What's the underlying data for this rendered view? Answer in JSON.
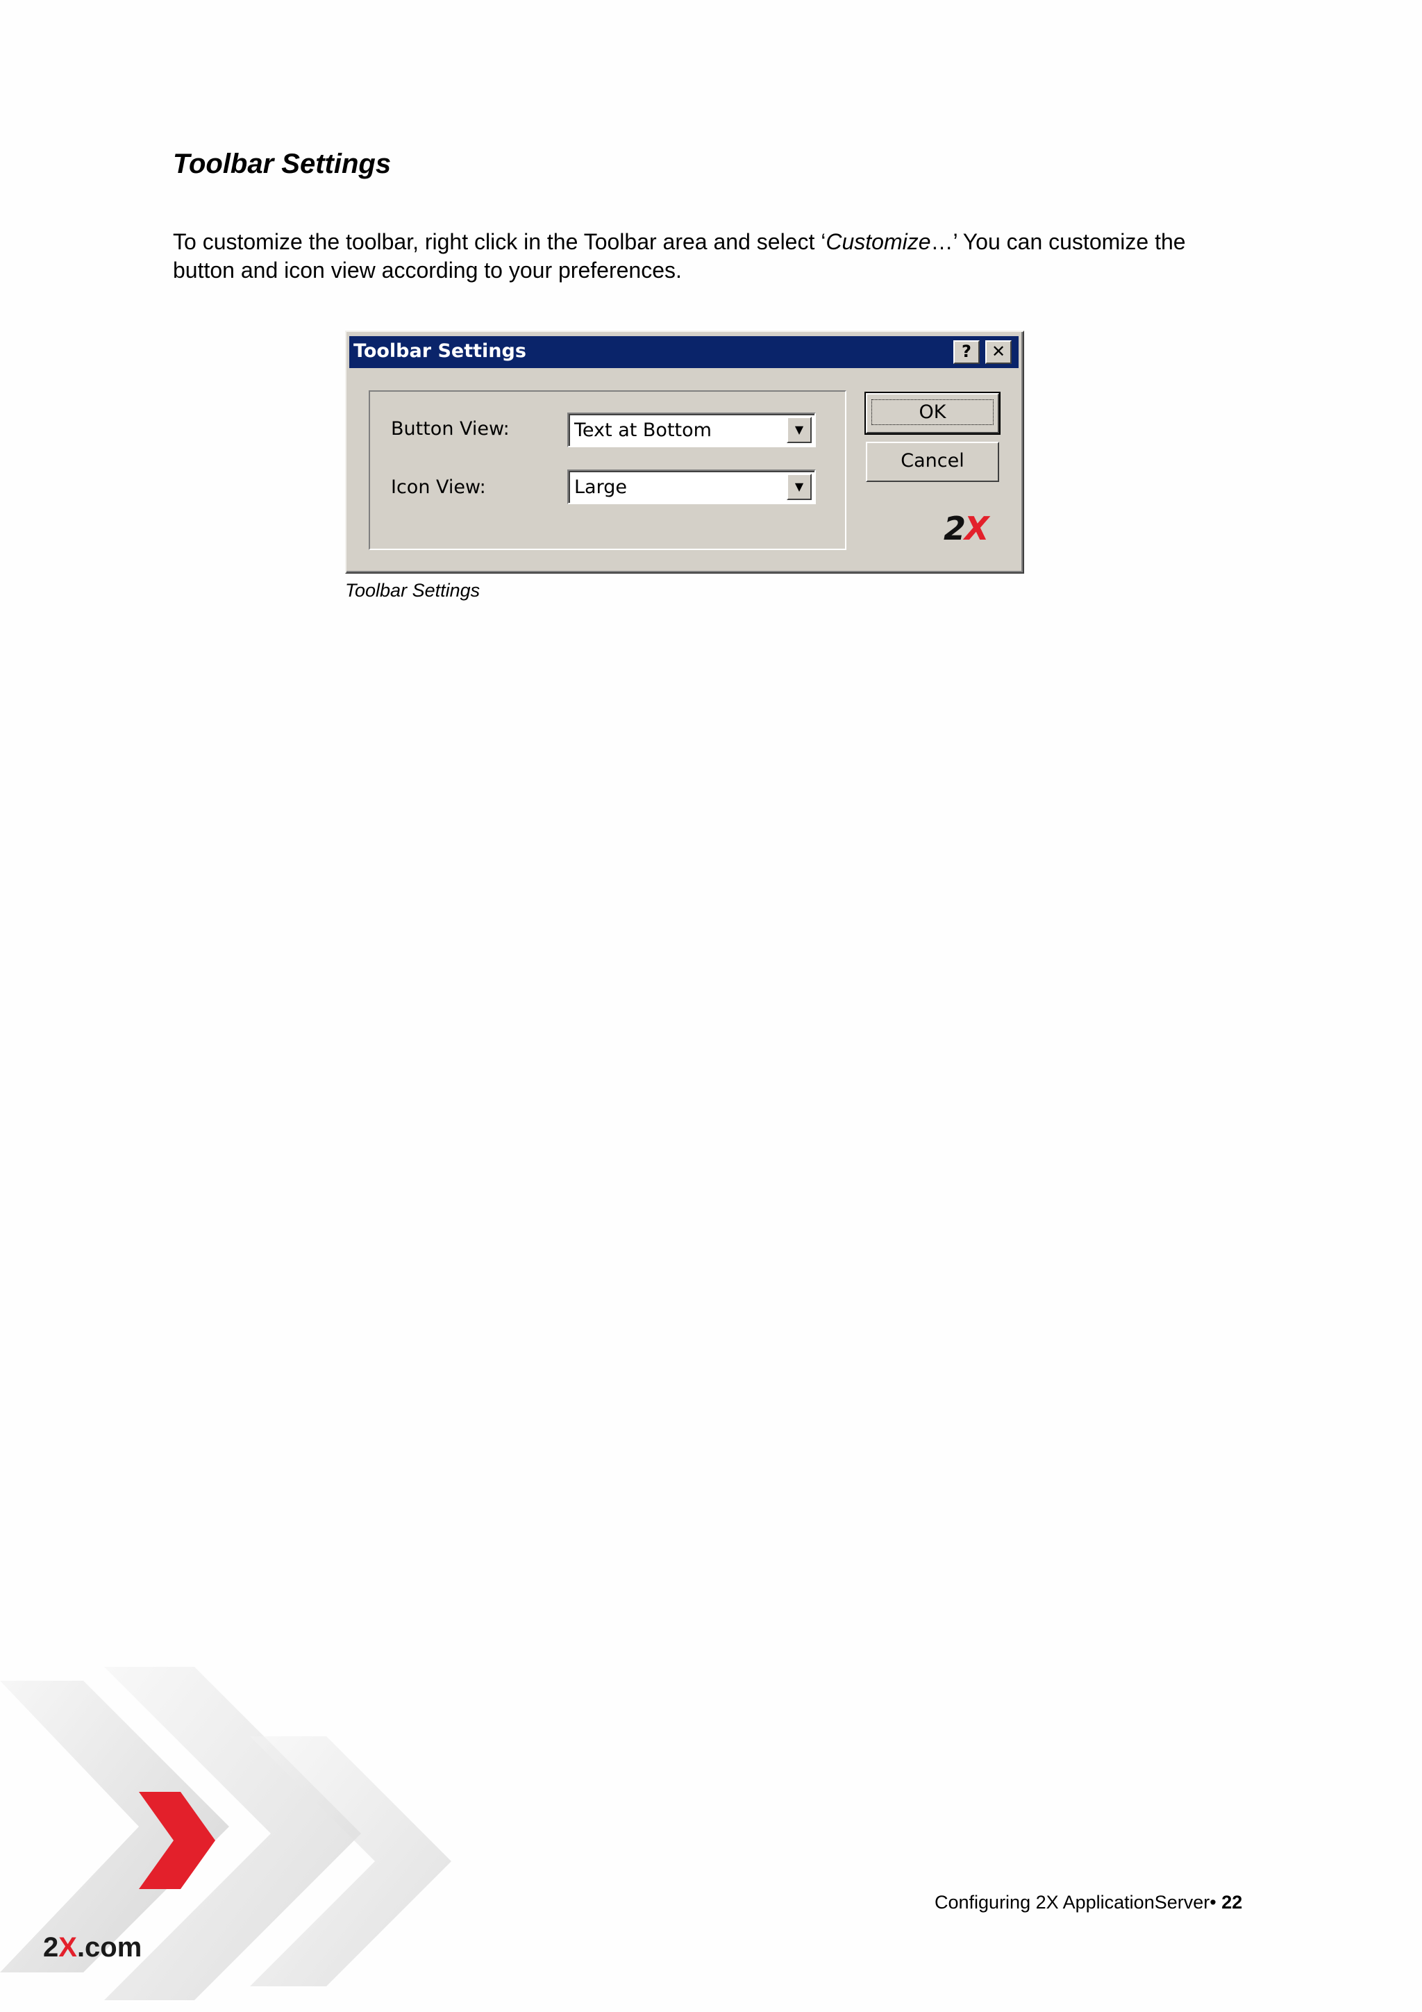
{
  "section_title": "Toolbar Settings",
  "intro": {
    "part1": "To customize the toolbar, right click in the Toolbar area and select ‘",
    "emphasis": "Customize",
    "part2": "…’ You can customize the button and icon view according to your preferences."
  },
  "dialog": {
    "title": "Toolbar Settings",
    "help_label": "?",
    "close_label": "✕",
    "button_view_label": "Button View:",
    "button_view_value": "Text at Bottom",
    "icon_view_label": "Icon View:",
    "icon_view_value": "Large",
    "dropdown_arrow": "▼",
    "ok_label": "OK",
    "cancel_label": "Cancel",
    "logo_num": "2",
    "logo_x": "X"
  },
  "caption": "Toolbar Settings",
  "brand": {
    "num": "2",
    "x": "X",
    "suffix": ".com"
  },
  "footer": {
    "text": "Configuring 2X ApplicationServer• ",
    "page": "22"
  },
  "colors": {
    "titlebar": "#0a246a",
    "dialog_face": "#d4d0c8",
    "brand_red": "#e3202b"
  }
}
